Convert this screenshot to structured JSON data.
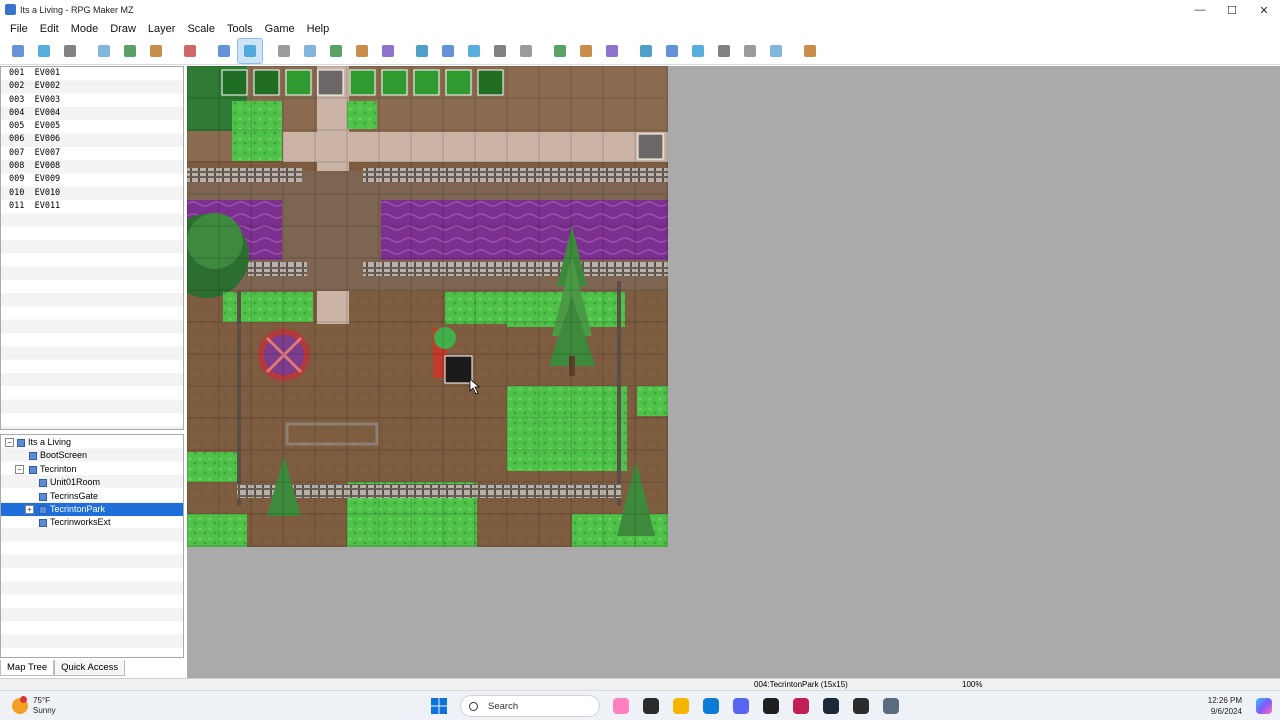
{
  "window": {
    "title": "Its a Living - RPG Maker MZ",
    "controls": {
      "minimize": "—",
      "maximize": "☐",
      "close": "✕"
    }
  },
  "menu": [
    "File",
    "Edit",
    "Mode",
    "Draw",
    "Layer",
    "Scale",
    "Tools",
    "Game",
    "Help"
  ],
  "toolbar": {
    "buttons": [
      {
        "name": "new-project-icon",
        "active": false
      },
      {
        "name": "open-project-icon",
        "active": false
      },
      {
        "name": "save-project-icon",
        "active": false
      },
      {
        "name": "sep"
      },
      {
        "name": "cut-icon",
        "active": false
      },
      {
        "name": "copy-icon",
        "active": false
      },
      {
        "name": "paste-icon",
        "active": false
      },
      {
        "name": "sep"
      },
      {
        "name": "undo-icon",
        "active": false
      },
      {
        "name": "sep"
      },
      {
        "name": "map-mode-icon",
        "active": false
      },
      {
        "name": "event-mode-icon",
        "active": true
      },
      {
        "name": "sep"
      },
      {
        "name": "layer-1-icon",
        "active": false
      },
      {
        "name": "layer-2-icon",
        "active": false
      },
      {
        "name": "layer-3-icon",
        "active": false
      },
      {
        "name": "layer-4-icon",
        "active": false
      },
      {
        "name": "layer-auto-icon",
        "active": false
      },
      {
        "name": "sep"
      },
      {
        "name": "pencil-icon",
        "active": false
      },
      {
        "name": "rectangle-icon",
        "active": false
      },
      {
        "name": "ellipse-icon",
        "active": false
      },
      {
        "name": "flood-fill-icon",
        "active": false
      },
      {
        "name": "shadow-pen-icon",
        "active": false
      },
      {
        "name": "sep"
      },
      {
        "name": "zoom-in-icon",
        "active": false
      },
      {
        "name": "zoom-out-icon",
        "active": false
      },
      {
        "name": "zoom-actual-icon",
        "active": false
      },
      {
        "name": "sep"
      },
      {
        "name": "database-icon",
        "active": false
      },
      {
        "name": "plugin-manager-icon",
        "active": false
      },
      {
        "name": "sound-test-icon",
        "active": false
      },
      {
        "name": "event-searcher-icon",
        "active": false
      },
      {
        "name": "resource-manager-icon",
        "active": false
      },
      {
        "name": "character-generator-icon",
        "active": false
      },
      {
        "name": "sep"
      },
      {
        "name": "playtest-icon",
        "active": false
      }
    ]
  },
  "events": [
    "001  EV001",
    "002  EV002",
    "003  EV003",
    "004  EV004",
    "005  EV005",
    "006  EV006",
    "007  EV007",
    "008  EV008",
    "009  EV009",
    "010  EV010",
    "011  EV011"
  ],
  "map_tree": {
    "items": [
      {
        "label": "Its a Living",
        "level": 0,
        "expander": "−",
        "selected": false,
        "root": true
      },
      {
        "label": "BootScreen",
        "level": 1,
        "expander": "",
        "selected": false
      },
      {
        "label": "Tecrinton",
        "level": 1,
        "expander": "−",
        "selected": false
      },
      {
        "label": "Unit01Room",
        "level": 2,
        "expander": "",
        "selected": false
      },
      {
        "label": "TecrinsGate",
        "level": 2,
        "expander": "",
        "selected": false
      },
      {
        "label": "TecrintonPark",
        "level": 2,
        "expander": "+",
        "selected": true
      },
      {
        "label": "TecrinworksExt",
        "level": 2,
        "expander": "",
        "selected": false
      }
    ]
  },
  "tabs": [
    {
      "label": "Map Tree",
      "active": true
    },
    {
      "label": "Quick Access",
      "active": false
    }
  ],
  "status": {
    "map_info": "004:TecrintonPark (15x15)",
    "zoom": "100%"
  },
  "taskbar": {
    "weather_temp": "75°F",
    "weather_desc": "Sunny",
    "search_placeholder": "Search",
    "time": "12:26 PM",
    "date": "9/6/2024",
    "apps": [
      "copilot-app-icon",
      "task-view-icon",
      "file-explorer-icon",
      "edge-icon",
      "discord-icon",
      "steam-link-icon",
      "rider-icon",
      "steam-icon",
      "chrome-icon",
      "rpg-maker-icon"
    ]
  }
}
